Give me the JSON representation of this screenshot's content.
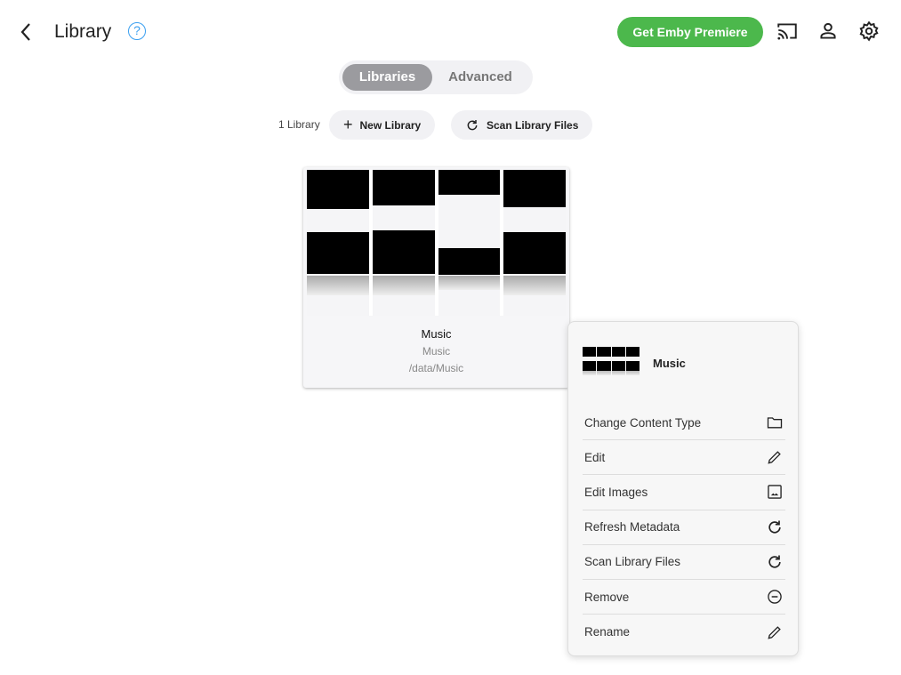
{
  "header": {
    "title": "Library",
    "help": "?",
    "premiere_label": "Get Emby Premiere"
  },
  "tabs": [
    {
      "label": "Libraries",
      "active": true
    },
    {
      "label": "Advanced",
      "active": false
    }
  ],
  "toolbar": {
    "count": "1 Library",
    "new_library": "New Library",
    "scan": "Scan Library Files"
  },
  "card": {
    "name": "Music",
    "type": "Music",
    "path": "/data/Music"
  },
  "menu": {
    "title": "Music",
    "items": [
      {
        "label": "Change Content Type",
        "icon": "folder-icon"
      },
      {
        "label": "Edit",
        "icon": "pencil-icon"
      },
      {
        "label": "Edit Images",
        "icon": "image-icon"
      },
      {
        "label": "Refresh Metadata",
        "icon": "refresh-icon"
      },
      {
        "label": "Scan Library Files",
        "icon": "refresh-icon"
      },
      {
        "label": "Remove",
        "icon": "remove-circle-icon"
      },
      {
        "label": "Rename",
        "icon": "pencil-icon"
      }
    ]
  },
  "colors": {
    "premiere": "#4cb84c",
    "help": "#3a9ff0"
  }
}
